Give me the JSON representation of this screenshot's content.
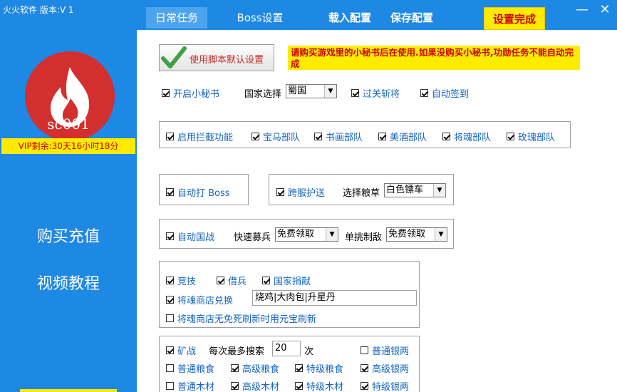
{
  "app": {
    "title": "火火软件 版本:V 1"
  },
  "tabs": [
    "日常任务",
    "Boss设置"
  ],
  "actions": {
    "load": "载入配置",
    "save": "保存配置",
    "finish": "设置完成"
  },
  "window": {
    "minimize": "—",
    "close": "✕"
  },
  "sidebar": {
    "username": "sc001",
    "vip": "VIP剩余:30天16小时18分",
    "links": [
      "购买充值",
      "视频教程"
    ]
  },
  "main": {
    "default_button": "使用脚本默认设置",
    "notice": "请购买游戏里的小秘书后在使用.如果没购买小秘书,功勋任务不能自动完成",
    "row1": {
      "secretary": "开启小秘书",
      "country_label": "国家选择",
      "country_value": "蜀国",
      "pass": "过关斩将",
      "signin": "自动签到"
    },
    "intercept": [
      "启用拦截功能",
      "宝马部队",
      "书画部队",
      "美酒部队",
      "将魂部队",
      "玫瑰部队"
    ],
    "boss": {
      "auto": "自动打 Boss"
    },
    "escort": {
      "cross": "跨服护送",
      "grain_label": "选择粮草",
      "grain_value": "白色镖车"
    },
    "war": {
      "auto": "自动国战",
      "recruit_label": "快速募兵",
      "recruit_value": "免费领取",
      "duel_label": "单挑制敌",
      "duel_value": "免费领取"
    },
    "misc": {
      "arena": "竞技",
      "borrow": "借兵",
      "donate": "国家捐献",
      "shop": "将魂商店兑换",
      "shop_items": "烧鸡|大肉包|升星丹",
      "refresh": "将魂商店无免死刷新时用元宝刷新"
    },
    "mine": {
      "war": "矿战",
      "search_label": "每次最多搜索",
      "search_value": "20",
      "times": "次",
      "options": [
        "普通银两",
        "普通粮食",
        "高级粮食",
        "特级粮食",
        "高级银两",
        "普通木材",
        "高级木材",
        "特级木材",
        "特级银两"
      ]
    }
  }
}
